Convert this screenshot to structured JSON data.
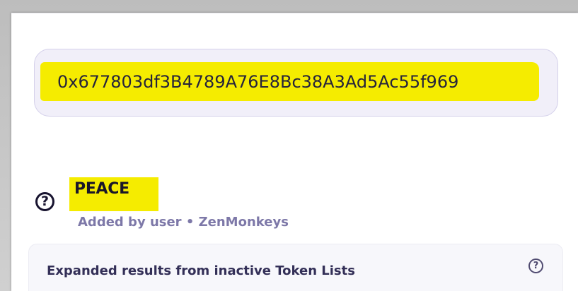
{
  "search": {
    "value": "0x677803df3B4789A76E8Bc38A3Ad5Ac55f969"
  },
  "token": {
    "unknown_icon": "?",
    "symbol": "PEACE",
    "meta": "Added by user • ZenMonkeys"
  },
  "expanded": {
    "title": "Expanded results from inactive Token Lists",
    "help_icon": "?"
  },
  "colors": {
    "highlight": "#f5ec00",
    "search_background": "#f1eff9",
    "meta_text": "#7d78a8",
    "primary_text": "#191629"
  },
  "icons": {
    "token_icon": "question-circle-icon",
    "help_icon": "question-circle-icon"
  }
}
